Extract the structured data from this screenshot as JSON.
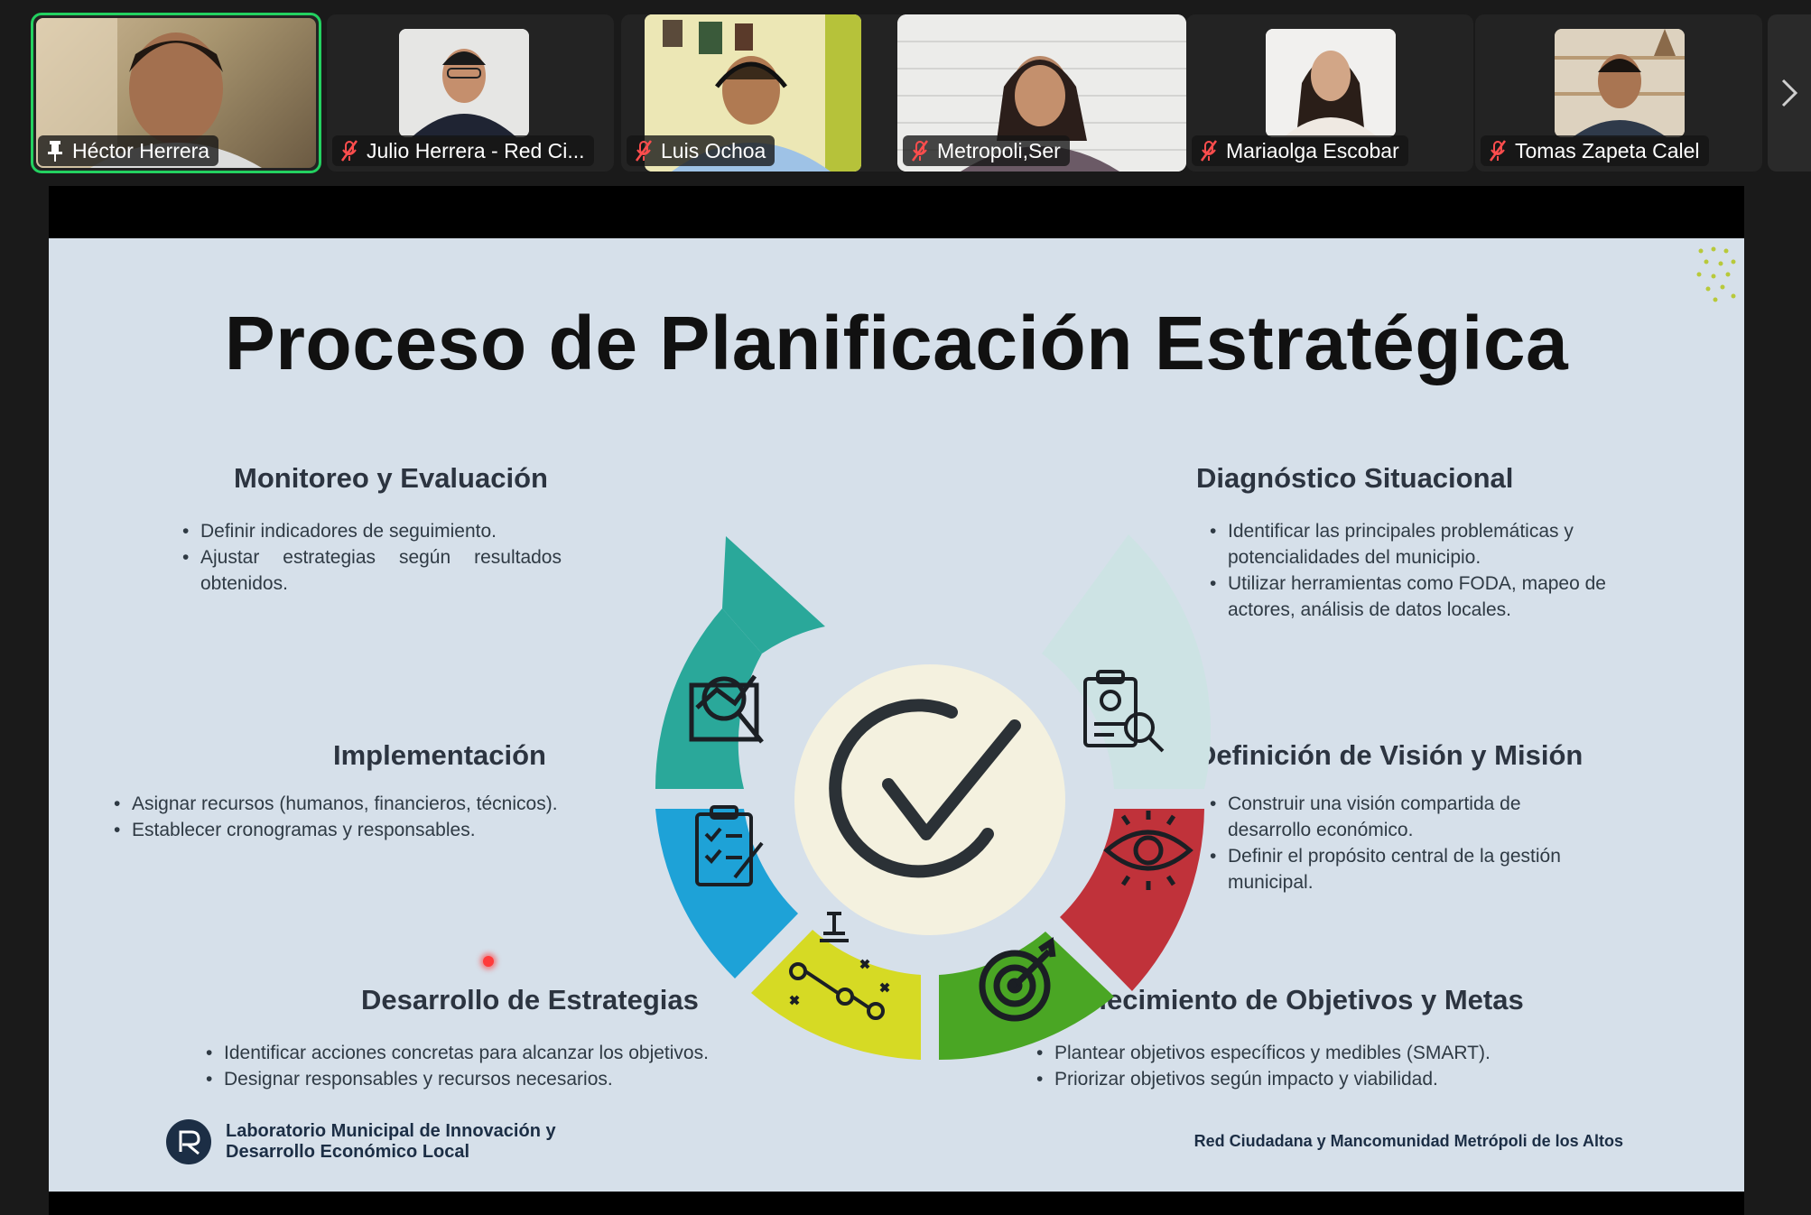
{
  "participants": [
    {
      "name": "Héctor Herrera",
      "muted": false,
      "pinned": true,
      "active": true
    },
    {
      "name": "Julio Herrera - Red Ci...",
      "muted": true
    },
    {
      "name": "Luis Ochoa",
      "muted": true
    },
    {
      "name": "Metropoli,Ser",
      "muted": true
    },
    {
      "name": "Mariaolga Escobar",
      "muted": true
    },
    {
      "name": "Tomas Zapeta Calel",
      "muted": true
    }
  ],
  "gallery": {
    "next_icon": "chevron-right-icon"
  },
  "slide": {
    "title": "Proceso de Planificación Estratégica",
    "sections": {
      "monitoreo": {
        "title": "Monitoreo y Evaluación",
        "items": [
          "Definir indicadores de seguimiento.",
          "Ajustar estrategias según resultados obtenidos."
        ]
      },
      "diagnostico": {
        "title": "Diagnóstico Situacional",
        "items": [
          "Identificar las principales problemáticas y potencialidades del municipio.",
          "Utilizar herramientas como FODA, mapeo de actores, análisis de datos locales."
        ]
      },
      "implementacion": {
        "title": "Implementación",
        "items": [
          "Asignar recursos (humanos, financieros, técnicos).",
          "Establecer cronogramas y responsables."
        ]
      },
      "vision": {
        "title": "Definición de Visión y Misión",
        "items": [
          "Construir una visión compartida de desarrollo económico.",
          "Definir el propósito central de la gestión municipal."
        ]
      },
      "estrategias": {
        "title": "Desarrollo de Estrategias",
        "items": [
          "Identificar acciones concretas para alcanzar los objetivos.",
          "Designar responsables y recursos necesarios."
        ]
      },
      "objetivos": {
        "title": "Establecimiento de Objetivos y Metas",
        "items": [
          "Plantear objetivos específicos y medibles (SMART).",
          "Priorizar objetivos según impacto y viabilidad."
        ]
      }
    },
    "footer_left": [
      "Laboratorio Municipal de Innovación y",
      "Desarrollo Económico Local"
    ],
    "footer_right": "Red Ciudadana y Mancomunidad Metrópoli de los Altos",
    "colors": {
      "teal": "#2aa89a",
      "light_teal": "#cde3e4",
      "blue": "#1ea2d7",
      "red": "#c0323a",
      "yellow": "#d6da24",
      "green": "#4aa624",
      "center": "#f4f1df"
    }
  }
}
